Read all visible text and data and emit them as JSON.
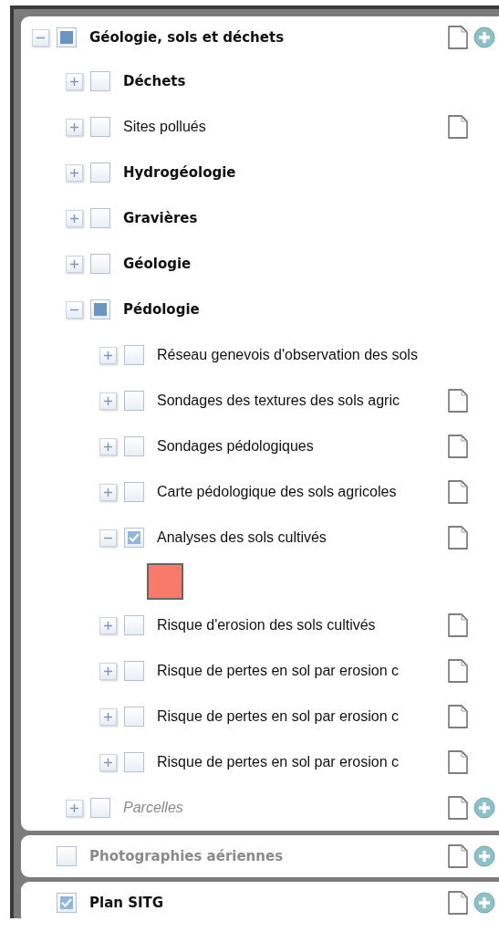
{
  "panels": [
    {
      "label": "Géologie, sols et déchets",
      "kind": "group",
      "greyed": false,
      "expanded": true,
      "checked": false,
      "partial": true,
      "doc": true,
      "add": true,
      "children": [
        {
          "label": "Déchets",
          "kind": "group",
          "greyed": false,
          "expanded": false,
          "checked": false,
          "partial": false,
          "doc": false,
          "add": false
        },
        {
          "label": "Sites pollués",
          "kind": "layer",
          "greyed": false,
          "expanded": false,
          "checked": false,
          "partial": false,
          "doc": true,
          "add": false
        },
        {
          "label": "Hydrogéologie",
          "kind": "group",
          "greyed": false,
          "expanded": false,
          "checked": false,
          "partial": false,
          "doc": false,
          "add": false
        },
        {
          "label": "Gravières",
          "kind": "group",
          "greyed": false,
          "expanded": false,
          "checked": false,
          "partial": false,
          "doc": false,
          "add": false
        },
        {
          "label": "Géologie",
          "kind": "group",
          "greyed": false,
          "expanded": false,
          "checked": false,
          "partial": false,
          "doc": false,
          "add": false
        },
        {
          "label": "Pédologie",
          "kind": "group",
          "greyed": false,
          "expanded": true,
          "checked": false,
          "partial": true,
          "doc": false,
          "add": false,
          "children": [
            {
              "label": "Réseau genevois d'observation des sols",
              "kind": "layer",
              "greyed": false,
              "expanded": false,
              "checked": false,
              "partial": false,
              "doc": false,
              "add": false
            },
            {
              "label": "Sondages des textures des sols agric",
              "kind": "layer",
              "greyed": false,
              "expanded": false,
              "checked": false,
              "partial": false,
              "doc": true,
              "add": false
            },
            {
              "label": "Sondages pédologiques",
              "kind": "layer",
              "greyed": false,
              "expanded": false,
              "checked": false,
              "partial": false,
              "doc": true,
              "add": false
            },
            {
              "label": "Carte pédologique des sols agricoles",
              "kind": "layer",
              "greyed": false,
              "expanded": false,
              "checked": false,
              "partial": false,
              "doc": true,
              "add": false
            },
            {
              "label": "Analyses des sols cultivés",
              "kind": "layer",
              "greyed": false,
              "expanded": true,
              "checked": true,
              "partial": false,
              "doc": true,
              "add": false,
              "legend": {
                "color": "#fa7a6a"
              }
            },
            {
              "label": "Risque d'erosion des sols cultivés",
              "kind": "layer",
              "greyed": false,
              "expanded": false,
              "checked": false,
              "partial": false,
              "doc": true,
              "add": false
            },
            {
              "label": "Risque de pertes en sol par erosion c",
              "kind": "layer",
              "greyed": false,
              "expanded": false,
              "checked": false,
              "partial": false,
              "doc": true,
              "add": false
            },
            {
              "label": "Risque de pertes en sol par erosion c",
              "kind": "layer",
              "greyed": false,
              "expanded": false,
              "checked": false,
              "partial": false,
              "doc": true,
              "add": false
            },
            {
              "label": "Risque de pertes en sol par erosion c",
              "kind": "layer",
              "greyed": false,
              "expanded": false,
              "checked": false,
              "partial": false,
              "doc": true,
              "add": false
            }
          ]
        },
        {
          "label": "Parcelles",
          "kind": "external",
          "greyed": true,
          "expanded": false,
          "checked": false,
          "partial": false,
          "doc": true,
          "add": true
        }
      ]
    },
    {
      "label": "Photographies aériennes",
      "kind": "group",
      "greyed": true,
      "checked": false,
      "partial": false,
      "doc": true,
      "add": true
    },
    {
      "label": "Plan SITG",
      "kind": "group",
      "greyed": false,
      "checked": true,
      "partial": false,
      "doc": true,
      "add": true
    }
  ]
}
